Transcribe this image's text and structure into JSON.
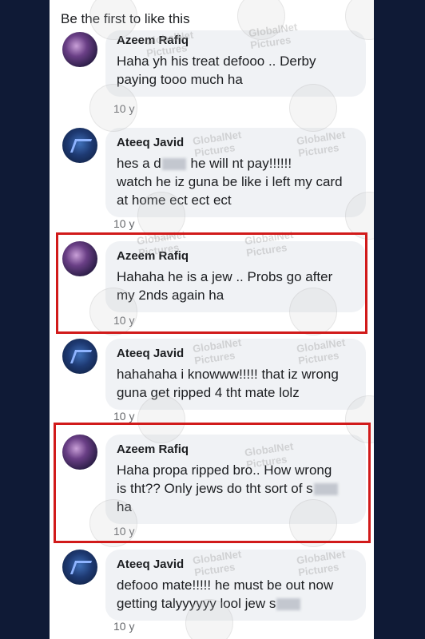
{
  "header": {
    "title": "Be the first to like this"
  },
  "comments": [
    {
      "author": "Azeem Rafiq",
      "line1": "Haha yh his treat defooo .. Derby",
      "line2": "paying tooo much ha",
      "time": "10 y"
    },
    {
      "author": "Ateeq Javid",
      "line1a": "hes a d",
      "line1b": " he will nt pay!!!!!!",
      "line2": "watch he iz guna be like i left my card",
      "line3": "at home ect ect ect",
      "time": "10 y"
    },
    {
      "author": "Azeem Rafiq",
      "line1": "Hahaha he is a jew .. Probs go after",
      "line2": "my 2nds again ha",
      "time": "10 y"
    },
    {
      "author": "Ateeq Javid",
      "line1": "hahahaha i knowww!!!!! that iz wrong",
      "line2": "guna get ripped 4 tht mate lolz",
      "time": "10 y"
    },
    {
      "author": "Azeem Rafiq",
      "line1": "Haha propa ripped bro.. How wrong",
      "line2a": "is tht?? Only jews do tht sort of s",
      "line3": "ha",
      "time": "10 y"
    },
    {
      "author": "Ateeq Javid",
      "line1": "defooo mate!!!!! he must be out now",
      "line2a": "getting talyyyyyy lool jew s",
      "time": "10 y"
    }
  ],
  "watermark": {
    "brand": "GlobalNet",
    "sub": "Pictures"
  },
  "colors": {
    "highlight": "#d11a1a",
    "bubble": "#f0f2f5",
    "background": "#0f1a36"
  }
}
